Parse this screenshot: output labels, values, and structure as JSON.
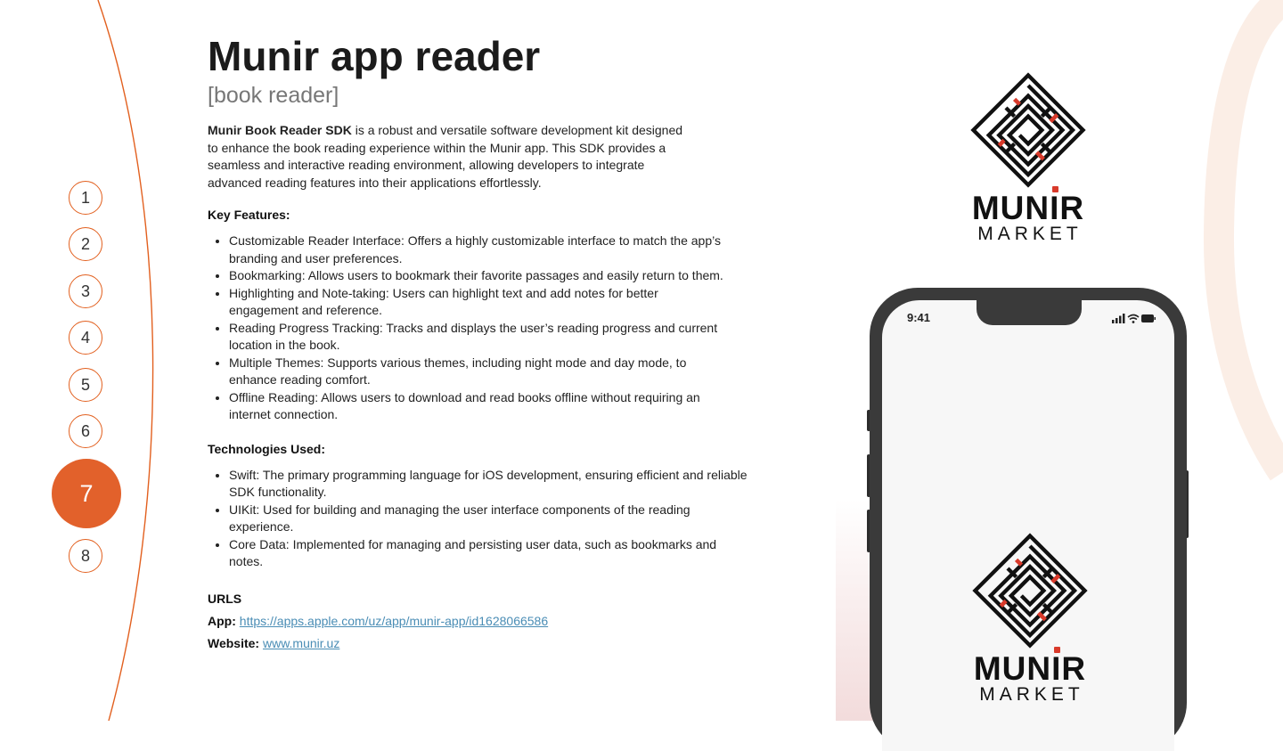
{
  "nav": {
    "pages": [
      "1",
      "2",
      "3",
      "4",
      "5",
      "6",
      "7",
      "8"
    ],
    "active": "7"
  },
  "header": {
    "title": "Munir app reader",
    "subtitle": "[book reader]"
  },
  "intro": {
    "lead_bold": "Munir Book Reader SDK",
    "text": " is a robust and versatile software development kit designed to enhance the book reading experience within the Munir app. This SDK provides a seamless and interactive reading environment, allowing developers to integrate advanced reading features into their applications effortlessly."
  },
  "features": {
    "heading": "Key Features:",
    "items": [
      "Customizable Reader Interface: Offers a highly customizable interface to match the app’s branding and user preferences.",
      "Bookmarking: Allows users to bookmark their favorite passages and easily return to them.",
      "Highlighting and Note-taking: Users can highlight text and add notes for better engagement and reference.",
      "Reading Progress Tracking: Tracks and displays the user’s reading progress and current location in the book.",
      "Multiple Themes: Supports various themes, including night mode and day mode, to enhance reading comfort.",
      "Offline Reading: Allows users to download and read books offline without requiring an internet connection."
    ]
  },
  "technologies": {
    "heading": "Technologies Used:",
    "items": [
      "Swift: The primary programming language for iOS development, ensuring efficient and reliable SDK functionality.",
      "UIKit: Used for building and managing the user interface components of the reading experience.",
      "Core Data: Implemented for managing and persisting user data, such as bookmarks and notes."
    ]
  },
  "urls": {
    "heading": "URLS",
    "app_label": "App:",
    "app_url": "https://apps.apple.com/uz/app/munir-app/id1628066586",
    "website_label": "Website:",
    "website_url": "www.munir.uz"
  },
  "logo": {
    "brand_pre": "MUN",
    "brand_i": "I",
    "brand_post": "R",
    "sub": "MARKET"
  },
  "phone": {
    "time": "9:41"
  },
  "colors": {
    "accent": "#e2612b",
    "link": "#4a8db5",
    "logo_red": "#d93a2b"
  }
}
